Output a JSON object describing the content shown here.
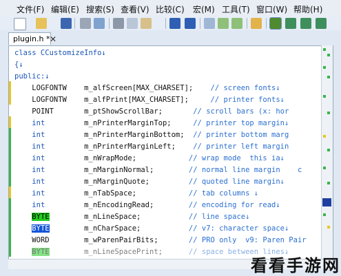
{
  "menubar": {
    "items": [
      "文件(F)",
      "编辑(E)",
      "搜索(S)",
      "查看(V)",
      "比较(C)",
      "宏(M)",
      "工具(T)",
      "窗口(W)",
      "帮助(H)"
    ]
  },
  "toolbar": {
    "icons": [
      "new-icon",
      "open-icon",
      "save-icon",
      "print-icon",
      "print-preview-icon",
      "cut-icon",
      "copy-icon",
      "paste-icon",
      "undo-icon",
      "redo-icon",
      "find-icon",
      "find-next-icon",
      "find-prev-icon",
      "bookmark-icon",
      "view-a-icon",
      "view-b-icon",
      "view-c-icon",
      "view-d-icon"
    ]
  },
  "tabs": [
    {
      "label": "plugin.h *"
    }
  ],
  "editor": {
    "lines": [
      {
        "type": "plain",
        "text": "class CCustomizeInfo↓"
      },
      {
        "type": "plain",
        "text": "{↓"
      },
      {
        "type": "plain",
        "text": "public:↓"
      },
      {
        "type": "decl",
        "ty": "LOGFONTW",
        "name": "m_alfScreen[MAX_CHARSET];",
        "comment": "// screen fonts↓",
        "pad": "    "
      },
      {
        "type": "decl",
        "ty": "LOGFONTW",
        "name": "m_alfPrint[MAX_CHARSET];",
        "comment": "// printer fonts↓",
        "pad": "     "
      },
      {
        "type": "decl",
        "ty": "POINT",
        "name": "m_ptShowScrollBar;",
        "comment": "// scroll bars (x: hor",
        "pad": "       "
      },
      {
        "type": "decl",
        "ty": "int",
        "name": "m_nPrinterMarginTop;",
        "comment": "// printer top margin↓",
        "pad": "     "
      },
      {
        "type": "decl",
        "ty": "int",
        "name": "m_nPrinterMarginBottom;",
        "comment": "// printer bottom marg",
        "pad": "  "
      },
      {
        "type": "decl",
        "ty": "int",
        "name": "m_nPrinterMarginLeft;",
        "comment": "// printer left margin",
        "pad": "    "
      },
      {
        "type": "decl",
        "ty": "int",
        "name": "m_nWrapMode;",
        "comment": "// wrap mode  this ia↓",
        "pad": "            "
      },
      {
        "type": "decl",
        "ty": "int",
        "name": "m_nMarginNormal;",
        "comment": "// normal line margin    c",
        "pad": "        "
      },
      {
        "type": "decl",
        "ty": "int",
        "name": "m_nMarginQuote;",
        "comment": "// quoted line margin↓",
        "pad": "         "
      },
      {
        "type": "decl",
        "ty": "int",
        "name": "m_nTabSpace;",
        "comment": "// tab columns ↓",
        "pad": "            "
      },
      {
        "type": "decl",
        "ty": "int",
        "name": "m_nEncodingRead;",
        "comment": "// encoding for read↓",
        "pad": "        "
      },
      {
        "type": "decl",
        "ty": "BYTE",
        "name": "m_nLineSpace;",
        "comment": "// line space↓",
        "pad": "           ",
        "hl": "green"
      },
      {
        "type": "decl",
        "ty": "BYTE",
        "name": "m_nCharSpace;",
        "comment": "// v7: character space↓",
        "pad": "           ",
        "hl": "blue"
      },
      {
        "type": "decl",
        "ty": "WORD",
        "name": "m_wParenPairBits;",
        "comment": "// PRO only  v9: Paren Pair",
        "pad": "       "
      },
      {
        "type": "decl",
        "ty": "BYTE",
        "name": "m_nLineSpacePrint;",
        "comment": "// space between lines↓",
        "pad": "      ",
        "hl": "fade"
      }
    ]
  },
  "watermark": {
    "text": "看看手游网"
  }
}
